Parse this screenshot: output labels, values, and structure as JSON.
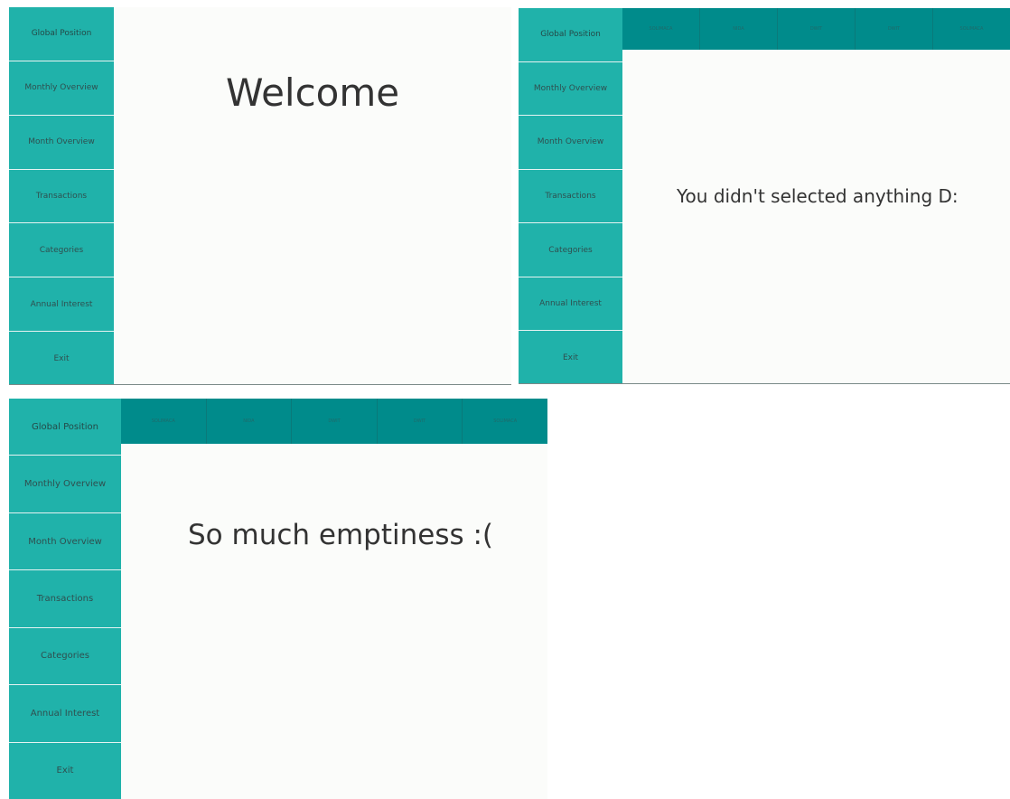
{
  "nav": {
    "items": [
      "Global Position",
      "Monthly Overview",
      "Month Overview",
      "Transactions",
      "Categories",
      "Annual Interest",
      "Exit"
    ]
  },
  "tabs": [
    "SOLIMACA",
    "NIDA",
    "DWIT",
    "DWIT",
    "SOLIMACA"
  ],
  "screens": {
    "welcome": {
      "message": "Welcome"
    },
    "nothing_selected": {
      "message": "You didn't selected anything D:"
    },
    "emptiness": {
      "message": "So much emptiness :("
    }
  },
  "colors": {
    "sidebar_button": "#20b2aa",
    "topbar": "#008b8b",
    "content_bg": "#fbfcfa",
    "text": "#333333"
  }
}
